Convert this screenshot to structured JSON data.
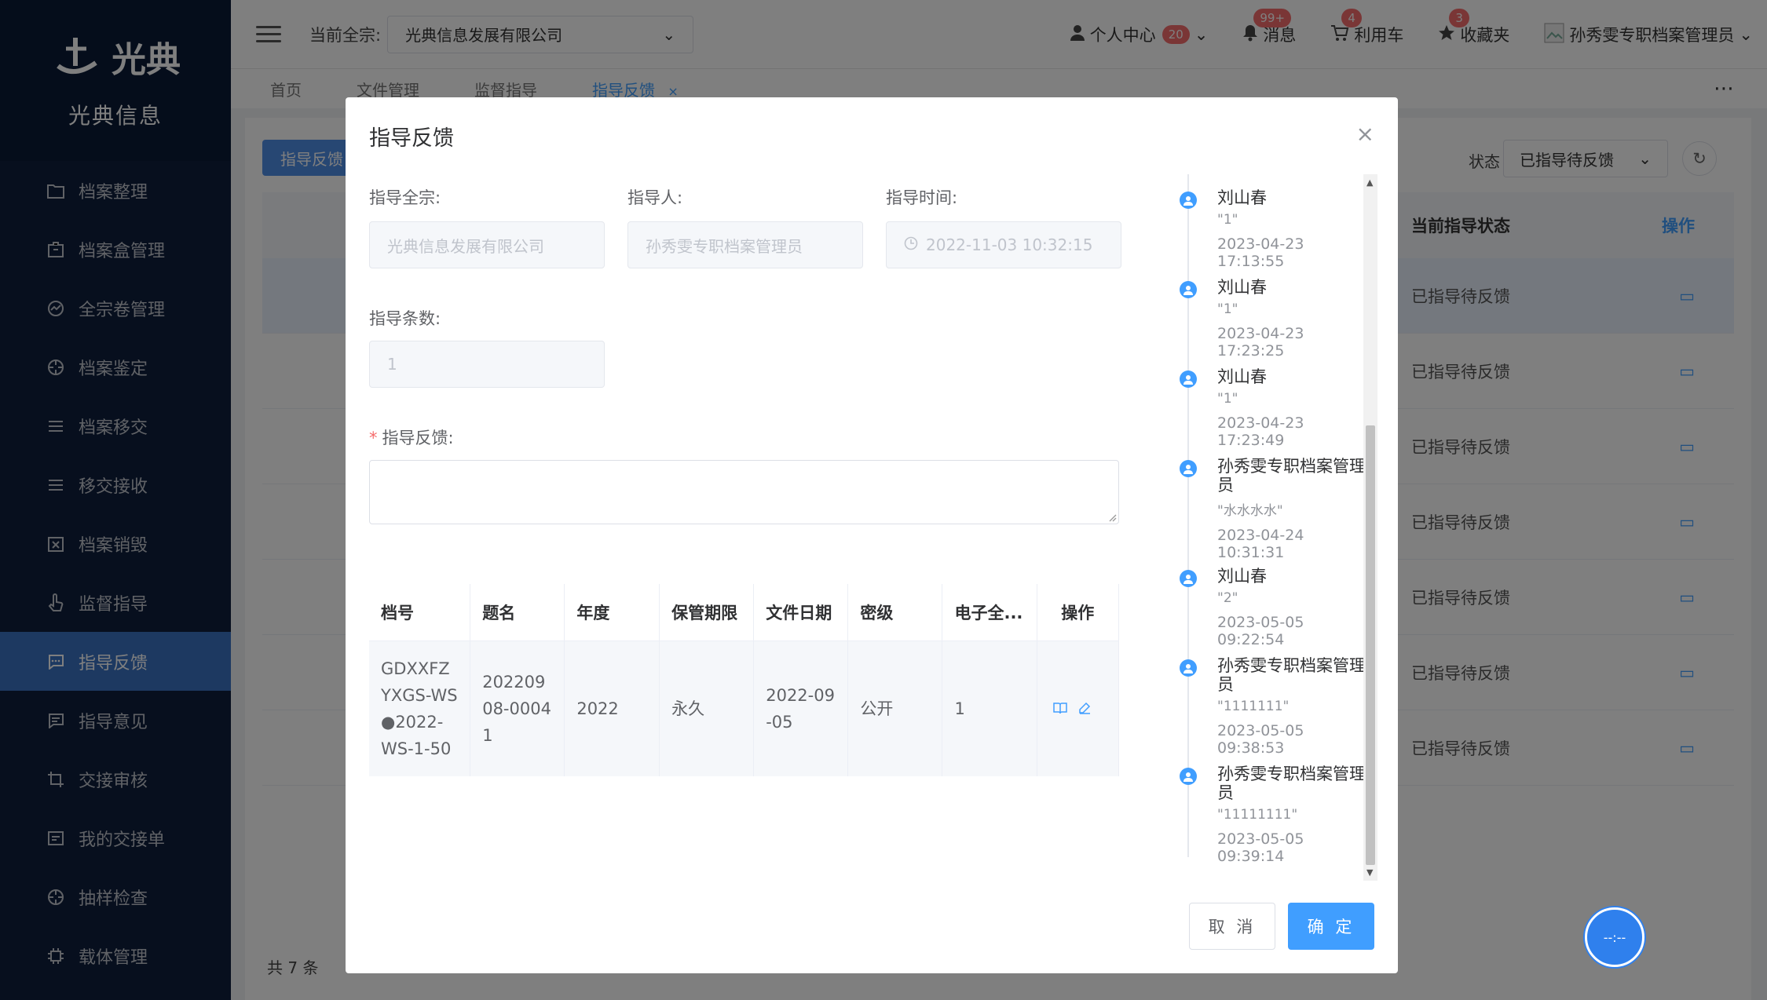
{
  "app": {
    "logo_text": "光典",
    "company": "光典信息"
  },
  "sidebar": {
    "items": [
      {
        "label": "档案整理",
        "icon": "folder-icon"
      },
      {
        "label": "档案盒管理",
        "icon": "box-icon"
      },
      {
        "label": "全宗卷管理",
        "icon": "chart-circle-icon"
      },
      {
        "label": "档案鉴定",
        "icon": "target-icon"
      },
      {
        "label": "档案移交",
        "icon": "list-icon"
      },
      {
        "label": "移交接收",
        "icon": "list-icon"
      },
      {
        "label": "档案销毁",
        "icon": "destroy-box-icon"
      },
      {
        "label": "监督指导",
        "icon": "hand-icon"
      },
      {
        "label": "指导反馈",
        "icon": "chat-icon"
      },
      {
        "label": "指导意见",
        "icon": "message-icon"
      },
      {
        "label": "交接审核",
        "icon": "crop-icon"
      },
      {
        "label": "我的交接单",
        "icon": "form-icon"
      },
      {
        "label": "抽样检查",
        "icon": "target-icon"
      },
      {
        "label": "载体管理",
        "icon": "chip-icon"
      }
    ]
  },
  "topbar": {
    "current_label": "当前全宗:",
    "current_value": "光典信息发展有限公司",
    "personal_center": "个人中心",
    "personal_badge": "20",
    "messages": "消息",
    "messages_badge": "99+",
    "cart": "利用车",
    "cart_badge": "4",
    "favorites": "收藏夹",
    "favorites_badge": "3",
    "user": "孙秀雯专职档案管理员"
  },
  "tabs": [
    {
      "label": "首页"
    },
    {
      "label": "文件管理"
    },
    {
      "label": "监督指导"
    },
    {
      "label": "指导反馈"
    }
  ],
  "background": {
    "button": "指导反馈",
    "status_label": "状态",
    "status_value": "已指导待反馈",
    "col_status": "当前指导状态",
    "col_op": "操作",
    "row_status": "已指导待反馈",
    "total": "共 7 条"
  },
  "modal": {
    "title": "指导反馈",
    "fonds_label": "指导全宗:",
    "fonds_value": "光典信息发展有限公司",
    "guide_person_label": "指导人:",
    "guide_person_value": "孙秀雯专职档案管理员",
    "guide_time_label": "指导时间:",
    "guide_time_value": "2022-11-03 10:32:15",
    "count_label": "指导条数:",
    "count_value": "1",
    "feedback_label": "指导反馈:",
    "feedback_value": "",
    "table": {
      "headers": [
        "档号",
        "题名",
        "年度",
        "保管期限",
        "文件日期",
        "密级",
        "电子全...",
        "操作"
      ],
      "rows": [
        [
          "GDXXFZYXGS-WS●2022-WS-1-50",
          "20220908-00041",
          "2022",
          "永久",
          "2022-09-05",
          "公开",
          "1"
        ]
      ]
    },
    "timeline": [
      {
        "name": "刘山春",
        "content": "\"1\"",
        "time": "2023-04-23 17:13:55"
      },
      {
        "name": "刘山春",
        "content": "\"1\"",
        "time": "2023-04-23 17:23:25"
      },
      {
        "name": "刘山春",
        "content": "\"1\"",
        "time": "2023-04-23 17:23:49"
      },
      {
        "name": "孙秀雯专职档案管理员",
        "content": "\"水水水水\"",
        "time": "2023-04-24 10:31:31"
      },
      {
        "name": "刘山春",
        "content": "\"2\"",
        "time": "2023-05-05 09:22:54"
      },
      {
        "name": "孙秀雯专职档案管理员",
        "content": "\"1111111\"",
        "time": "2023-05-05 09:38:53"
      },
      {
        "name": "孙秀雯专职档案管理员",
        "content": "\"11111111\"",
        "time": "2023-05-05 09:39:14"
      }
    ],
    "cancel": "取 消",
    "confirm": "确 定"
  },
  "float_ball": "--:--"
}
